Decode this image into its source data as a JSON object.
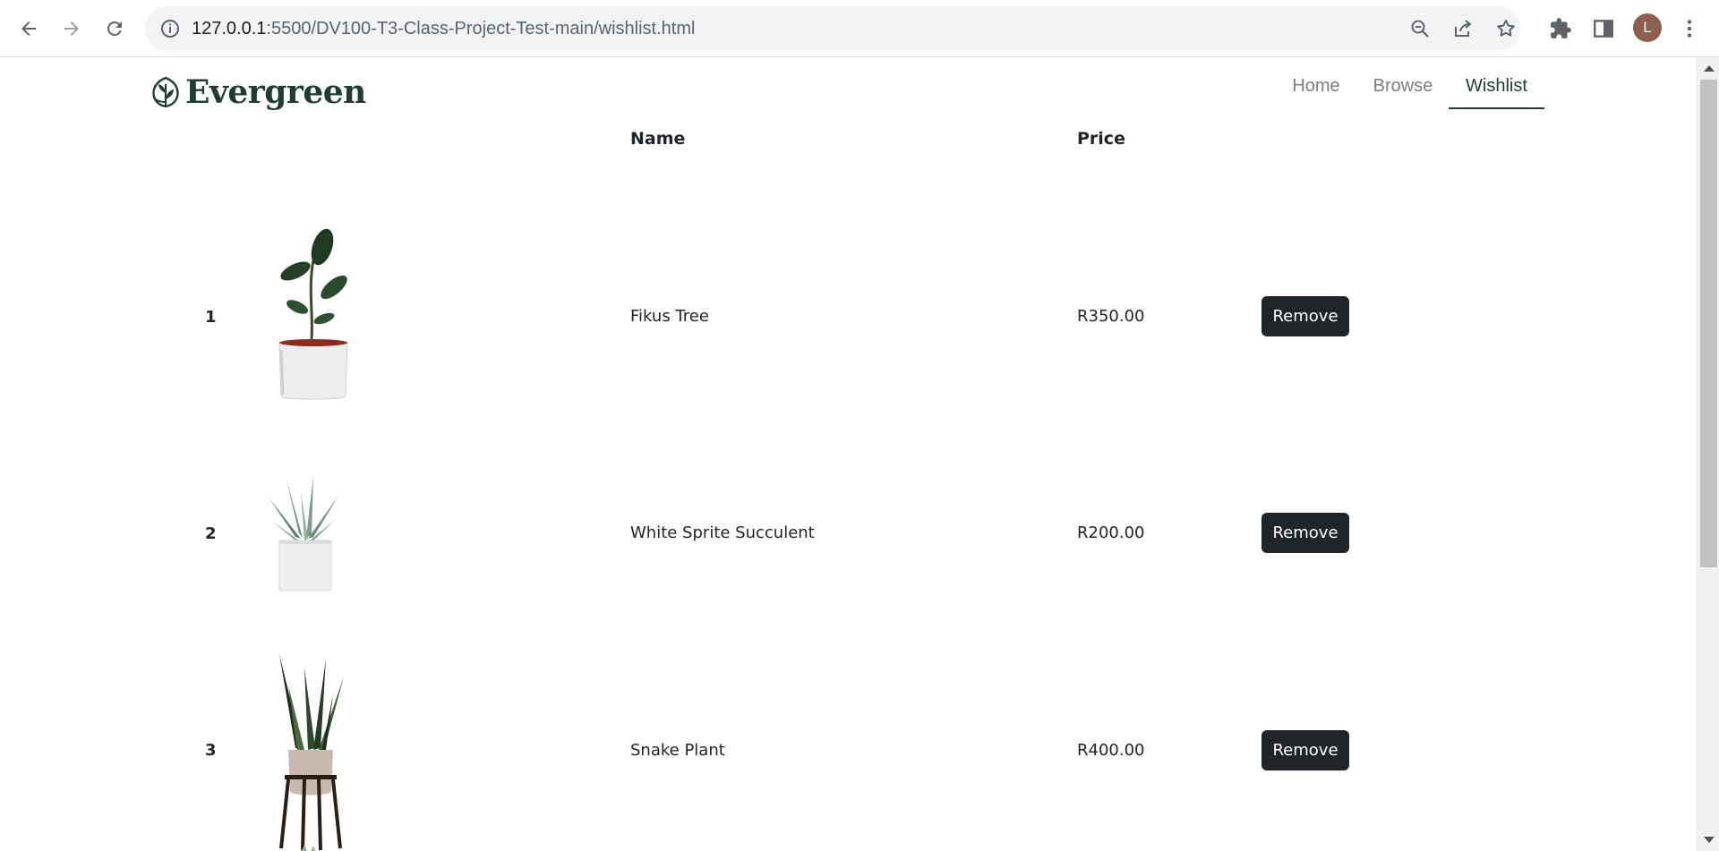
{
  "browser": {
    "url_host": "127.0.0.1",
    "url_path": ":5500/DV100-T3-Class-Project-Test-main/wishlist.html",
    "profile_initial": "L"
  },
  "site": {
    "logo_text": "Evergreen",
    "nav": [
      {
        "label": "Home",
        "active": false
      },
      {
        "label": "Browse",
        "active": false
      },
      {
        "label": "Wishlist",
        "active": true
      }
    ]
  },
  "table": {
    "headers": {
      "name": "Name",
      "price": "Price"
    },
    "rows": [
      {
        "num": "1",
        "name": "Fikus Tree",
        "price": "R350.00",
        "button": "Remove",
        "image": "fikus-tree-icon"
      },
      {
        "num": "2",
        "name": "White Sprite Succulent",
        "price": "R200.00",
        "button": "Remove",
        "image": "succulent-icon"
      },
      {
        "num": "3",
        "name": "Snake Plant",
        "price": "R400.00",
        "button": "Remove",
        "image": "snake-plant-icon"
      }
    ]
  },
  "colors": {
    "brand": "#1f3d33",
    "button_bg": "#212529",
    "nav_inactive": "#7b7f84"
  }
}
